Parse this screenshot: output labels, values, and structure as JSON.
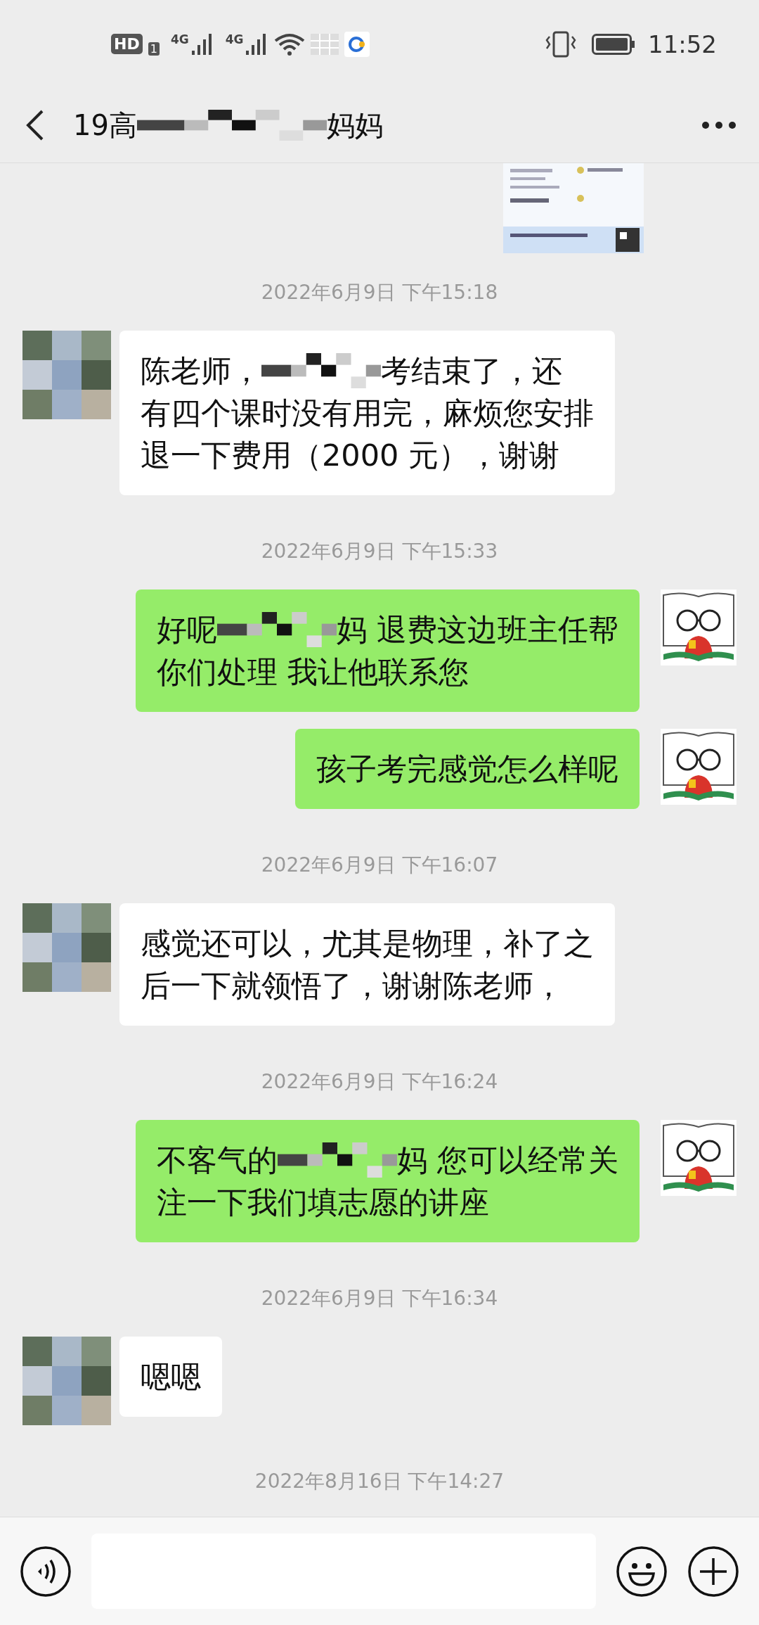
{
  "status_bar": {
    "hd_badge": "HD",
    "sim_number": "1",
    "networks": [
      "4G",
      "4G"
    ],
    "time": "11:52"
  },
  "header": {
    "title_parts": [
      {
        "kind": "text",
        "text": "19高"
      },
      {
        "kind": "mosaic"
      },
      {
        "kind": "text",
        "text": "妈妈"
      }
    ]
  },
  "chat": [
    {
      "kind": "picture"
    },
    {
      "kind": "timestamp",
      "text": "2022年6月9日 下午15:18"
    },
    {
      "kind": "message",
      "outgoing": false,
      "lines": [
        [
          {
            "kind": "text",
            "text": "陈老师，"
          },
          {
            "kind": "mosaic"
          },
          {
            "kind": "text",
            "text": "考结束了，还"
          }
        ],
        [
          {
            "kind": "text",
            "text": "有四个课时没有用完，麻烦您安排"
          }
        ],
        [
          {
            "kind": "text",
            "text": "退一下费用（2000 元），谢谢"
          }
        ]
      ]
    },
    {
      "kind": "timestamp",
      "text": "2022年6月9日 下午15:33"
    },
    {
      "kind": "message",
      "outgoing": true,
      "lines": [
        [
          {
            "kind": "text",
            "text": "好呢"
          },
          {
            "kind": "mosaic"
          },
          {
            "kind": "text",
            "text": "妈 退费这边班主任帮"
          }
        ],
        [
          {
            "kind": "text",
            "text": "你们处理 我让他联系您"
          }
        ]
      ]
    },
    {
      "kind": "message",
      "outgoing": true,
      "lines": [
        [
          {
            "kind": "text",
            "text": "孩子考完感觉怎么样呢"
          }
        ]
      ]
    },
    {
      "kind": "timestamp",
      "text": "2022年6月9日 下午16:07"
    },
    {
      "kind": "message",
      "outgoing": false,
      "lines": [
        [
          {
            "kind": "text",
            "text": "感觉还可以，尤其是物理，补了之"
          }
        ],
        [
          {
            "kind": "text",
            "text": "后一下就领悟了，谢谢陈老师，"
          }
        ]
      ]
    },
    {
      "kind": "timestamp",
      "text": "2022年6月9日 下午16:24"
    },
    {
      "kind": "message",
      "outgoing": true,
      "lines": [
        [
          {
            "kind": "text",
            "text": "不客气的"
          },
          {
            "kind": "mosaic"
          },
          {
            "kind": "text",
            "text": "妈 您可以经常关"
          }
        ],
        [
          {
            "kind": "text",
            "text": "注一下我们填志愿的讲座"
          }
        ]
      ]
    },
    {
      "kind": "timestamp",
      "text": "2022年6月9日 下午16:34"
    },
    {
      "kind": "message",
      "outgoing": false,
      "lines": [
        [
          {
            "kind": "text",
            "text": "嗯嗯"
          }
        ]
      ]
    },
    {
      "kind": "timestamp",
      "text": "2022年8月16日 下午14:27"
    }
  ]
}
